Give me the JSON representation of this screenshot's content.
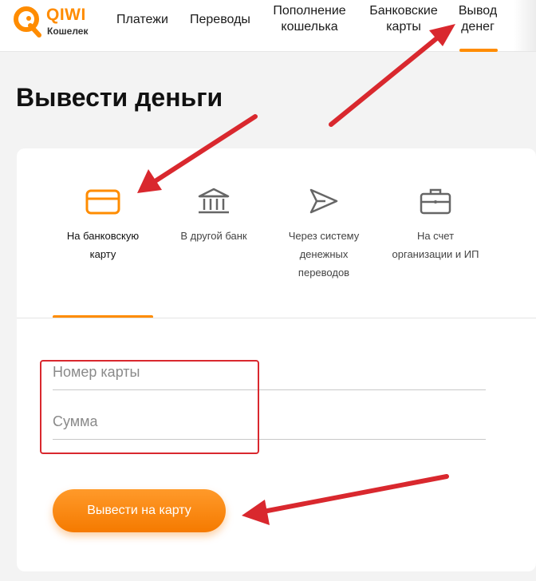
{
  "header": {
    "logo": {
      "brand": "QIWI",
      "subtitle": "Кошелек",
      "color": "#ff8c00"
    },
    "nav": [
      {
        "line1": "Платежи",
        "line2": ""
      },
      {
        "line1": "Переводы",
        "line2": ""
      },
      {
        "line1": "Пополнение",
        "line2": "кошелька"
      },
      {
        "line1": "Банковские",
        "line2": "карты"
      },
      {
        "line1": "Вывод",
        "line2": "денег",
        "active": true
      }
    ]
  },
  "page": {
    "title": "Вывести деньги"
  },
  "tabs": [
    {
      "icon": "credit-card-icon",
      "line1": "На банковскую",
      "line2": "карту",
      "line3": "",
      "active": true
    },
    {
      "icon": "bank-icon",
      "line1": "В другой банк",
      "line2": "",
      "line3": ""
    },
    {
      "icon": "paper-plane-icon",
      "line1": "Через систему",
      "line2": "денежных",
      "line3": "переводов"
    },
    {
      "icon": "briefcase-icon",
      "line1": "На счет",
      "line2": "организации и ИП",
      "line3": ""
    }
  ],
  "form": {
    "card_number": {
      "placeholder": "Номер карты",
      "value": ""
    },
    "amount": {
      "placeholder": "Сумма",
      "value": ""
    },
    "submit_label": "Вывести на карту"
  },
  "colors": {
    "accent": "#ff8c00",
    "annotation": "#d9282e",
    "background": "#f3f3f3"
  }
}
